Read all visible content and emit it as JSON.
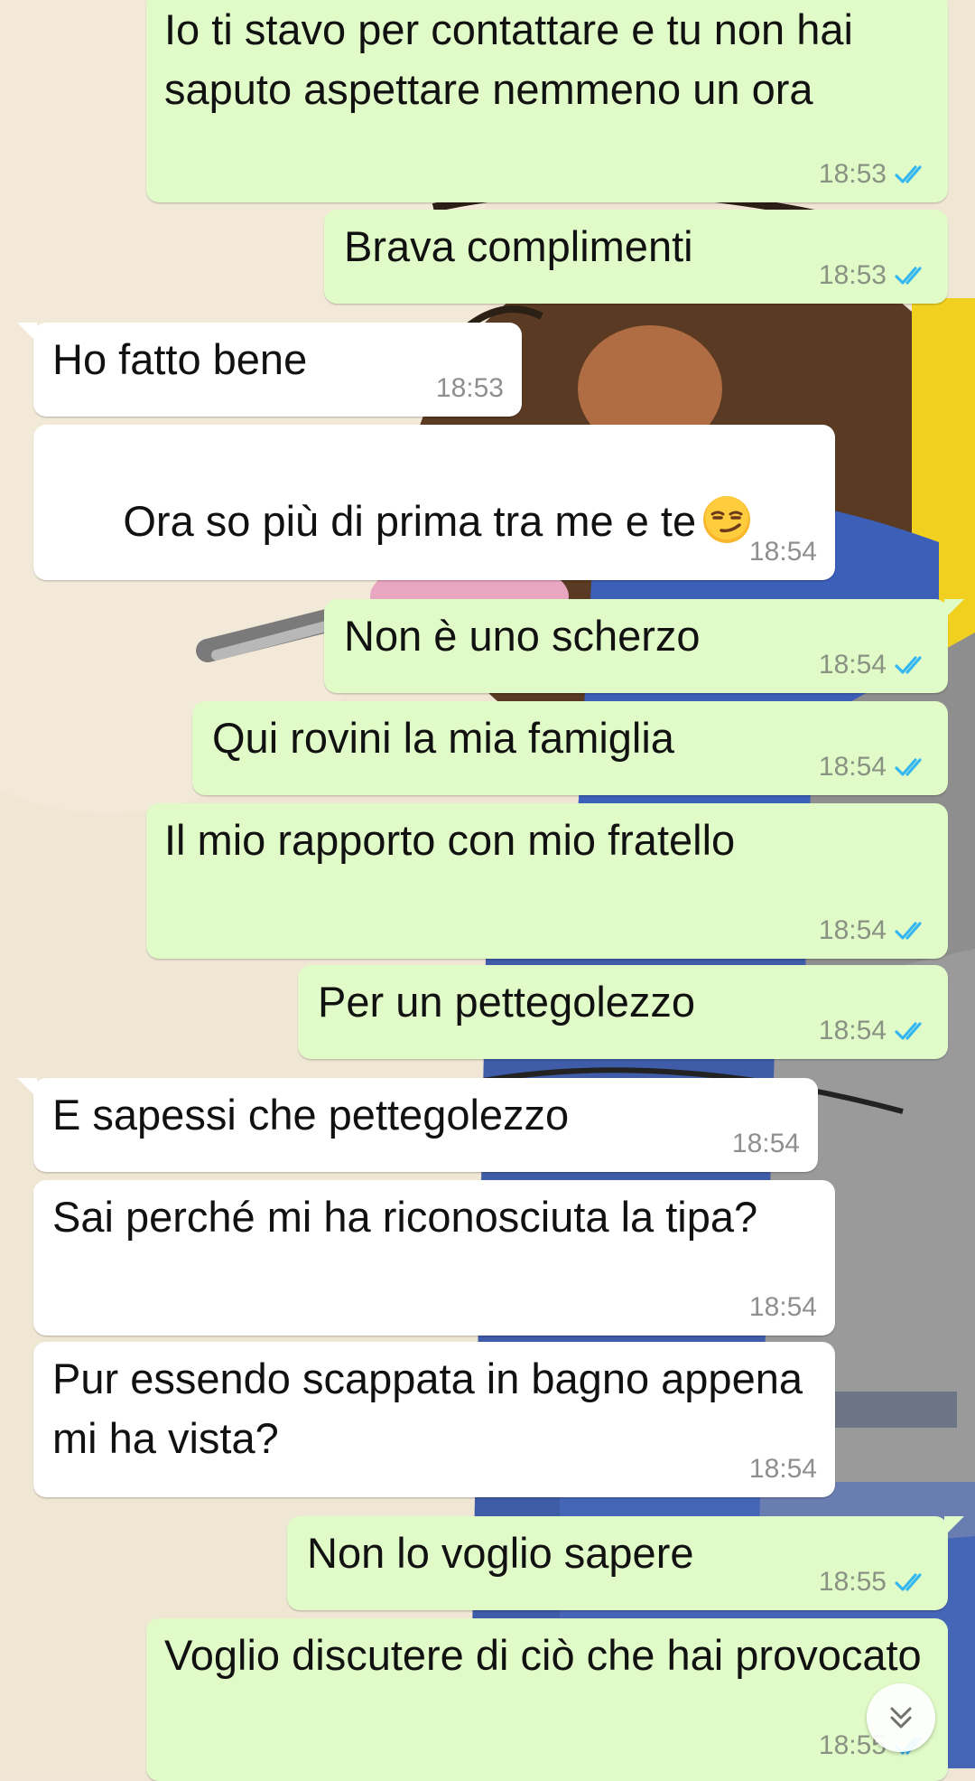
{
  "theme": {
    "outgoing_bubble": "#e1fbc8",
    "incoming_bubble": "#ffffff",
    "read_tick_color": "#34b7f1",
    "wallpaper": "cartoon-character-wallpaper"
  },
  "messages": [
    {
      "direction": "out",
      "text": "Io ti stavo per contattare e tu non hai saputo aspettare nemmeno un ora",
      "time": "18:53",
      "status": "read"
    },
    {
      "direction": "out",
      "text": "Brava complimenti",
      "time": "18:53",
      "status": "read"
    },
    {
      "direction": "in",
      "text": "Ho fatto bene",
      "time": "18:53"
    },
    {
      "direction": "in",
      "text": "Ora so più di prima tra me e te",
      "emoji": "smirking-face-emoji",
      "time": "18:54"
    },
    {
      "direction": "out",
      "text": "Non è uno scherzo",
      "time": "18:54",
      "status": "read"
    },
    {
      "direction": "out",
      "text": "Qui rovini la mia famiglia",
      "time": "18:54",
      "status": "read"
    },
    {
      "direction": "out",
      "text": "Il mio rapporto con mio fratello",
      "time": "18:54",
      "status": "read"
    },
    {
      "direction": "out",
      "text": "Per un pettegolezzo",
      "time": "18:54",
      "status": "read"
    },
    {
      "direction": "in",
      "text": "E sapessi che pettegolezzo",
      "time": "18:54"
    },
    {
      "direction": "in",
      "text": "Sai perché mi ha riconosciuta la tipa?",
      "time": "18:54"
    },
    {
      "direction": "in",
      "text": "Pur essendo scappata in bagno appena mi ha vista?",
      "time": "18:54"
    },
    {
      "direction": "out",
      "text": "Non lo voglio sapere",
      "time": "18:55",
      "status": "read"
    },
    {
      "direction": "out",
      "text": "Voglio discutere di ciò che hai provocato",
      "time": "18:55",
      "status": "read"
    }
  ],
  "scroll_button": {
    "icon": "double-chevron-down-icon"
  }
}
